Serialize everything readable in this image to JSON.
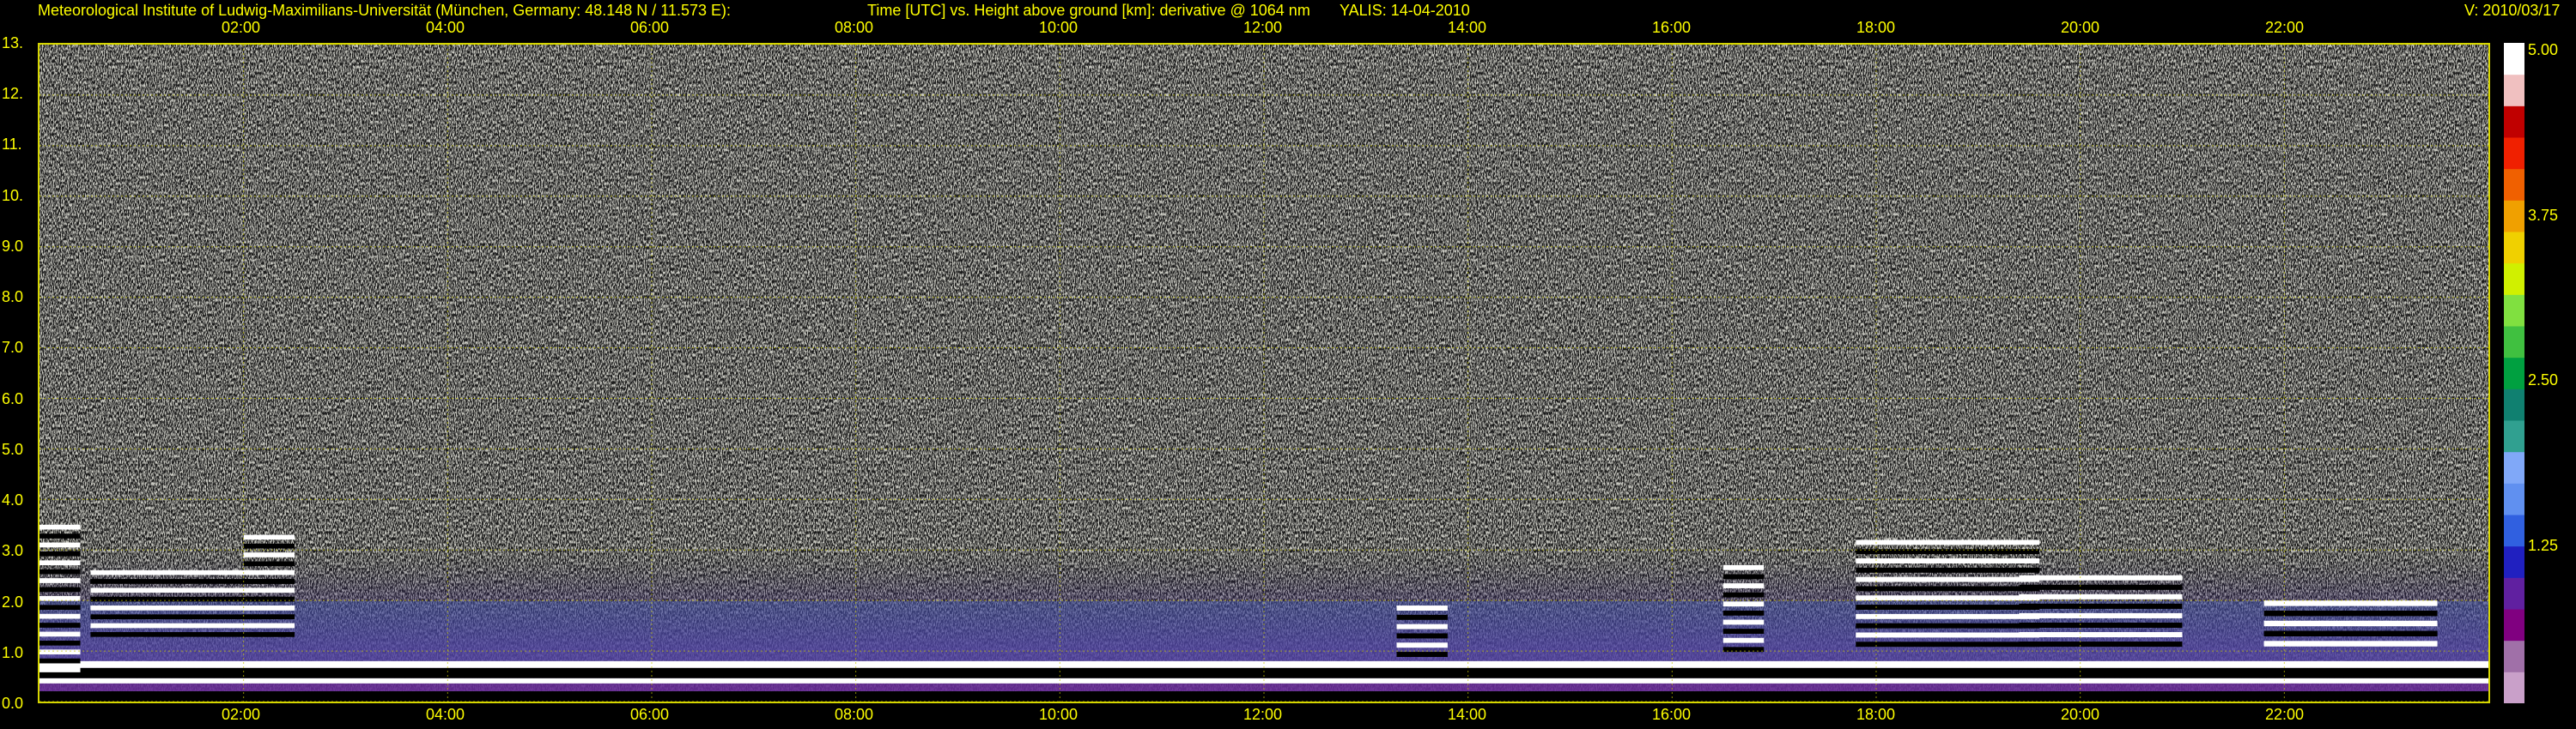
{
  "header": {
    "institute": "Meteorological Institute of Ludwig-Maximilians-Universität (München, Germany: 48.148 N / 11.573 E):",
    "axis_desc": "Time [UTC] vs. Height above ground [km]: derivative @ 1064 nm",
    "instrument": "YALIS: 14-04-2010",
    "version": "V: 2010/03/17"
  },
  "chart_data": {
    "type": "heatmap",
    "x_ticks": [
      "02:00",
      "04:00",
      "06:00",
      "08:00",
      "10:00",
      "12:00",
      "14:00",
      "16:00",
      "18:00",
      "20:00",
      "22:00"
    ],
    "x_tick_hours": [
      2,
      4,
      6,
      8,
      10,
      12,
      14,
      16,
      18,
      20,
      22
    ],
    "xlim_hours": [
      0,
      24
    ],
    "y_ticks": [
      "0.0",
      "1.0",
      "2.0",
      "3.0",
      "4.0",
      "5.0",
      "6.0",
      "7.0",
      "8.0",
      "9.0",
      "10.",
      "11.",
      "12.",
      "13."
    ],
    "y_tick_values": [
      0,
      1,
      2,
      3,
      4,
      5,
      6,
      7,
      8,
      9,
      10,
      11,
      12,
      13
    ],
    "ylim": [
      0,
      13
    ],
    "grid": true,
    "colorbar": {
      "ticks": [
        "5.00",
        "3.75",
        "2.50",
        "1.25"
      ],
      "tick_values": [
        5.0,
        3.75,
        2.5,
        1.25
      ],
      "range": [
        0,
        5
      ],
      "colors": [
        "#c9a0c9",
        "#a070a8",
        "#800080",
        "#6020a0",
        "#2020c0",
        "#3060e0",
        "#6090f0",
        "#80a8f8",
        "#30a090",
        "#108070",
        "#00a040",
        "#40c040",
        "#80e040",
        "#d0f000",
        "#f0d000",
        "#f0a000",
        "#f06000",
        "#f02000",
        "#c00000",
        "#f0c0c0",
        "#ffffff"
      ]
    },
    "features": {
      "surface_layer_top_km": 0.8,
      "aerosol_layer_top_km": 3.0,
      "cloud_segments": [
        {
          "start_h": 0.0,
          "end_h": 0.4,
          "base_km": 0.5,
          "top_km": 3.5
        },
        {
          "start_h": 0.5,
          "end_h": 2.5,
          "base_km": 1.2,
          "top_km": 2.6
        },
        {
          "start_h": 2.0,
          "end_h": 2.5,
          "base_km": 1.2,
          "top_km": 3.3
        },
        {
          "start_h": 17.8,
          "end_h": 19.6,
          "base_km": 1.0,
          "top_km": 3.2
        },
        {
          "start_h": 19.4,
          "end_h": 21.0,
          "base_km": 1.0,
          "top_km": 2.5
        },
        {
          "start_h": 21.8,
          "end_h": 23.5,
          "base_km": 1.0,
          "top_km": 2.0
        },
        {
          "start_h": 13.3,
          "end_h": 13.8,
          "base_km": 0.8,
          "top_km": 1.9
        },
        {
          "start_h": 16.5,
          "end_h": 16.9,
          "base_km": 0.9,
          "top_km": 2.7
        }
      ]
    }
  }
}
